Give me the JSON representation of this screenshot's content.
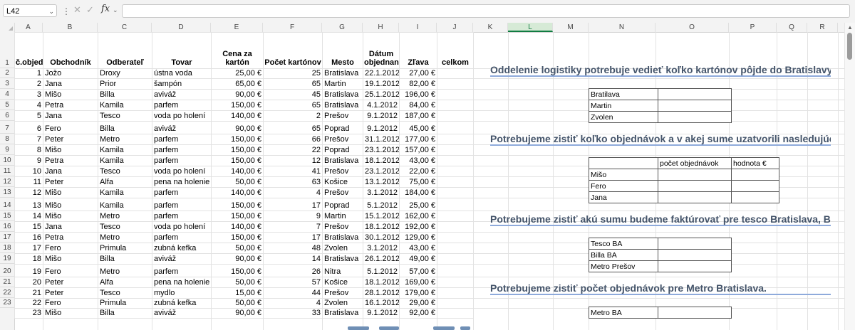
{
  "formula_bar": {
    "name_box": "L42",
    "fx_label": "fx",
    "formula_value": ""
  },
  "columns": [
    "A",
    "B",
    "C",
    "D",
    "E",
    "F",
    "G",
    "H",
    "I",
    "J",
    "K",
    "L",
    "M",
    "N",
    "O",
    "P",
    "Q",
    "R"
  ],
  "selected_column": "L",
  "rows": [
    "1",
    "2",
    "3",
    "4",
    "5",
    "6",
    "7",
    "8",
    "9",
    "10",
    "11",
    "12",
    "13",
    "14",
    "15",
    "16",
    "17",
    "18",
    "19",
    "20",
    "21",
    "22",
    "23"
  ],
  "table": {
    "headers": [
      "č.objed.",
      "Obchodník",
      "Odberateľ",
      "Tovar",
      "Cena za kartón",
      "Počet kartónov",
      "Mesto",
      "Dátum objednania",
      "Zľava",
      "celkom"
    ],
    "rows": [
      [
        "1",
        "Jožo",
        "Droxy",
        "ústna voda",
        "25,00 €",
        "25",
        "Bratislava",
        "22.1.2012",
        "27,00 €",
        ""
      ],
      [
        "2",
        "Jana",
        "Prior",
        "šampón",
        "65,00 €",
        "65",
        "Martin",
        "19.1.2012",
        "82,00 €",
        ""
      ],
      [
        "3",
        "Mišo",
        "Billa",
        "aviváž",
        "90,00 €",
        "45",
        "Bratislava",
        "25.1.2012",
        "196,00 €",
        ""
      ],
      [
        "4",
        "Petra",
        "Kamila",
        "parfem",
        "150,00 €",
        "65",
        "Bratislava",
        "4.1.2012",
        "84,00 €",
        ""
      ],
      [
        "5",
        "Jana",
        "Tesco",
        "voda po holení",
        "140,00 €",
        "2",
        "Prešov",
        "9.1.2012",
        "187,00 €",
        ""
      ],
      [
        "6",
        "Fero",
        "Billa",
        "aviváž",
        "90,00 €",
        "65",
        "Poprad",
        "9.1.2012",
        "45,00 €",
        ""
      ],
      [
        "7",
        "Peter",
        "Metro",
        "parfem",
        "150,00 €",
        "66",
        "Prešov",
        "31.1.2012",
        "177,00 €",
        ""
      ],
      [
        "8",
        "Mišo",
        "Kamila",
        "parfem",
        "150,00 €",
        "22",
        "Poprad",
        "23.1.2012",
        "157,00 €",
        ""
      ],
      [
        "9",
        "Petra",
        "Kamila",
        "parfem",
        "150,00 €",
        "12",
        "Bratislava",
        "18.1.2012",
        "43,00 €",
        ""
      ],
      [
        "10",
        "Jana",
        "Tesco",
        "voda po holení",
        "140,00 €",
        "41",
        "Prešov",
        "23.1.2012",
        "22,00 €",
        ""
      ],
      [
        "11",
        "Peter",
        "Alfa",
        "pena na holenie",
        "50,00 €",
        "63",
        "Košice",
        "13.1.2012",
        "75,00 €",
        ""
      ],
      [
        "12",
        "Mišo",
        "Kamila",
        "parfem",
        "140,00 €",
        "4",
        "Prešov",
        "3.1.2012",
        "184,00 €",
        ""
      ],
      [
        "13",
        "Mišo",
        "Kamila",
        "parfem",
        "150,00 €",
        "17",
        "Poprad",
        "5.1.2012",
        "25,00 €",
        ""
      ],
      [
        "14",
        "Mišo",
        "Metro",
        "parfem",
        "150,00 €",
        "9",
        "Martin",
        "15.1.2012",
        "162,00 €",
        ""
      ],
      [
        "15",
        "Jana",
        "Tesco",
        "voda po holení",
        "140,00 €",
        "7",
        "Prešov",
        "18.1.2012",
        "192,00 €",
        ""
      ],
      [
        "16",
        "Petra",
        "Metro",
        "parfem",
        "150,00 €",
        "17",
        "Bratislava",
        "30.1.2012",
        "129,00 €",
        ""
      ],
      [
        "17",
        "Fero",
        "Primula",
        "zubná kefka",
        "50,00 €",
        "48",
        "Zvolen",
        "3.1.2012",
        "43,00 €",
        ""
      ],
      [
        "18",
        "Mišo",
        "Billa",
        "aviváž",
        "90,00 €",
        "14",
        "Bratislava",
        "26.1.2012",
        "49,00 €",
        ""
      ],
      [
        "19",
        "Fero",
        "Metro",
        "parfem",
        "150,00 €",
        "26",
        "Nitra",
        "5.1.2012",
        "57,00 €",
        ""
      ],
      [
        "20",
        "Peter",
        "Alfa",
        "pena na holenie",
        "50,00 €",
        "57",
        "Košice",
        "18.1.2012",
        "169,00 €",
        ""
      ],
      [
        "21",
        "Peter",
        "Tesco",
        "mydlo",
        "15,00 €",
        "44",
        "Prešov",
        "28.1.2012",
        "179,00 €",
        ""
      ],
      [
        "22",
        "Fero",
        "Primula",
        "zubná kefka",
        "50,00 €",
        "4",
        "Zvolen",
        "16.1.2012",
        "29,00 €",
        ""
      ],
      [
        "23",
        "Mišo",
        "Billa",
        "aviváž",
        "90,00 €",
        "33",
        "Bratislava",
        "9.1.2012",
        "92,00 €",
        ""
      ]
    ]
  },
  "tasks": [
    {
      "heading": "Oddelenie logistiky potrebuje vedieť koľko kartónov pôjde do Bratislavy, Martina a Zvolena.",
      "rows": [
        "Bratilava",
        "Martin",
        "Zvolen"
      ]
    },
    {
      "heading": "Potrebujeme zistiť koľko objednávok a v akej sume uzatvorili nasledujúci obchodníci.",
      "col_headers": [
        "počet objednávok",
        "hodnota €"
      ],
      "rows": [
        "Mišo",
        "Fero",
        "Jana"
      ]
    },
    {
      "heading": "Potrebujeme zistiť akú sumu budeme faktúrovať pre tesco Bratislava, Billa Bratislava a Metro Prešov.",
      "rows": [
        "Tesco BA",
        "Billa BA",
        "Metro Prešov"
      ]
    },
    {
      "heading": "Potrebujeme zistiť počet objednávok pre Metro Bratislava.",
      "rows": [
        "Metro BA"
      ]
    }
  ]
}
